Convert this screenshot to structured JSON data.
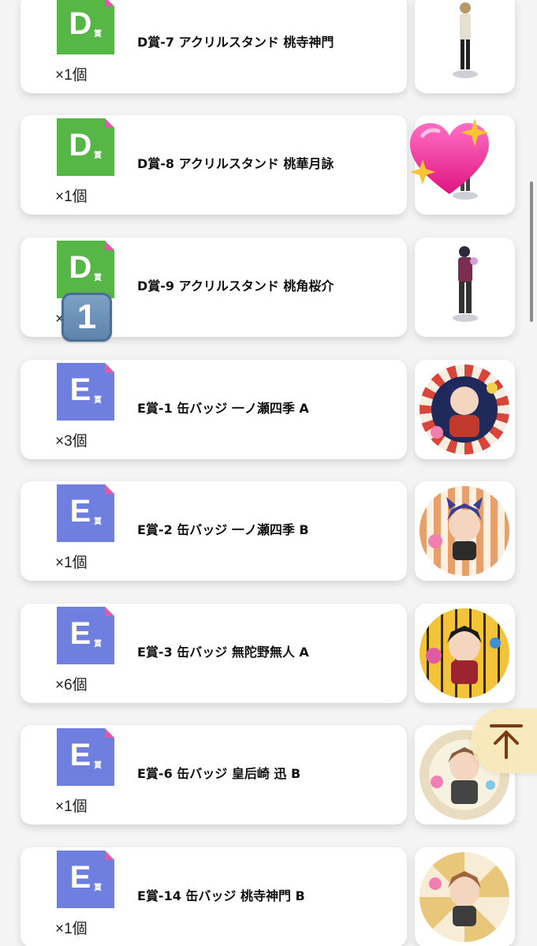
{
  "prizes": [
    {
      "grade": "D",
      "grade_suffix": "賞",
      "name": "D賞-7 アクリルスタンド 桃寺神門",
      "qty": "×1個",
      "kind": "acrylic"
    },
    {
      "grade": "D",
      "grade_suffix": "賞",
      "name": "D賞-8 アクリルスタンド 桃華月詠",
      "qty": "×1個",
      "kind": "acrylic"
    },
    {
      "grade": "D",
      "grade_suffix": "賞",
      "name": "D賞-9 アクリルスタンド 桃角桜介",
      "qty": "×2個",
      "kind": "acrylic"
    },
    {
      "grade": "E",
      "grade_suffix": "賞",
      "name": "E賞-1 缶バッジ 一ノ瀬四季 A",
      "qty": "×3個",
      "kind": "can"
    },
    {
      "grade": "E",
      "grade_suffix": "賞",
      "name": "E賞-2 缶バッジ 一ノ瀬四季 B",
      "qty": "×1個",
      "kind": "can"
    },
    {
      "grade": "E",
      "grade_suffix": "賞",
      "name": "E賞-3 缶バッジ 無陀野無人 A",
      "qty": "×6個",
      "kind": "can"
    },
    {
      "grade": "E",
      "grade_suffix": "賞",
      "name": "E賞-6 缶バッジ 皇后崎 迅 B",
      "qty": "×1個",
      "kind": "can"
    },
    {
      "grade": "E",
      "grade_suffix": "賞",
      "name": "E賞-14 缶バッジ 桃寺神門 B",
      "qty": "×1個",
      "kind": "can"
    }
  ],
  "grade_colors": {
    "D": "#56b646",
    "E": "#6f7fe0",
    "corner": "#e25aa6"
  },
  "overlays": {
    "sticker_heart": "sparkling-heart-emoji",
    "keycap_digit": "1",
    "scroll_top_icon": "arrow-up-to-top-icon"
  }
}
